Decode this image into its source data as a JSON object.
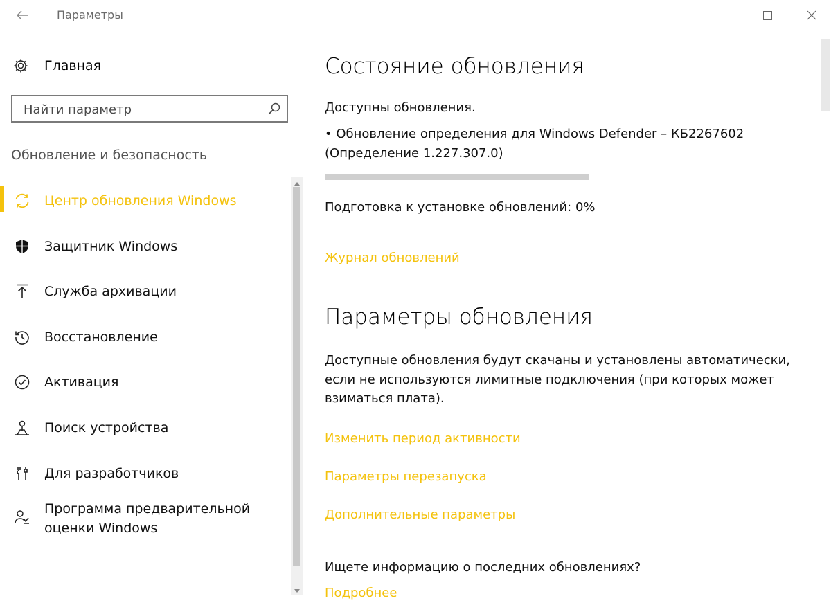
{
  "window": {
    "title": "Параметры"
  },
  "sidebar": {
    "home_label": "Главная",
    "search_placeholder": "Найти параметр",
    "section_title": "Обновление и безопасность",
    "items": [
      {
        "label": "Центр обновления Windows",
        "icon": "refresh-icon",
        "active": true
      },
      {
        "label": "Защитник Windows",
        "icon": "shield-icon",
        "active": false
      },
      {
        "label": "Служба архивации",
        "icon": "upload-arrow-icon",
        "active": false
      },
      {
        "label": "Восстановление",
        "icon": "history-icon",
        "active": false
      },
      {
        "label": "Активация",
        "icon": "check-circle-icon",
        "active": false
      },
      {
        "label": "Поиск устройства",
        "icon": "person-location-icon",
        "active": false
      },
      {
        "label": "Для разработчиков",
        "icon": "tools-icon",
        "active": false
      },
      {
        "label": "Программа предварительной оценки Windows",
        "icon": "person-insider-icon",
        "active": false
      }
    ]
  },
  "main": {
    "status_heading": "Состояние обновления",
    "available_text": "Доступны обновления.",
    "update_line1": "• Обновление определения для Windows Defender – КБ2267602",
    "update_line2": "(Определение 1.227.307.0)",
    "progress_fraction": 0,
    "progress_text": "Подготовка к установке обновлений: 0%",
    "history_link": "Журнал обновлений",
    "settings_heading": "Параметры обновления",
    "settings_line1": "Доступные обновления будут скачаны и установлены автоматически,",
    "settings_line2": "если не используются лимитные подключения (при которых может",
    "settings_line3": "взиматься плата).",
    "link_active_hours": "Изменить период активности",
    "link_restart": "Параметры перезапуска",
    "link_advanced": "Дополнительные параметры",
    "info_question": "Ищете информацию о последних обновлениях?",
    "link_more": "Подробнее"
  },
  "colors": {
    "accent": "#f4c20d",
    "text": "#111111",
    "muted": "#555555"
  }
}
